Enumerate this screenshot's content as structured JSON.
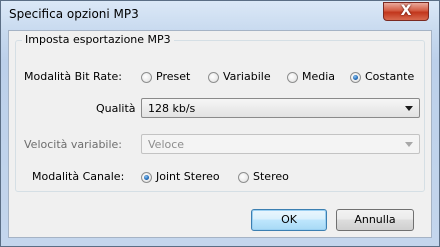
{
  "window": {
    "title": "Specifica opzioni MP3",
    "close_glyph": "X"
  },
  "group": {
    "title": "Imposta esportazione MP3",
    "bitrate_mode": {
      "label": "Modalità Bit Rate:",
      "options": [
        "Preset",
        "Variabile",
        "Media",
        "Costante"
      ],
      "selected": "Costante"
    },
    "quality": {
      "label": "Qualità",
      "value": "128 kb/s"
    },
    "variable_speed": {
      "label": "Velocità variabile:",
      "value": "Veloce",
      "enabled": false
    },
    "channel_mode": {
      "label": "Modalità Canale:",
      "options": [
        "Joint Stereo",
        "Stereo"
      ],
      "selected": "Joint Stereo"
    }
  },
  "buttons": {
    "ok": "OK",
    "cancel": "Annulla"
  }
}
